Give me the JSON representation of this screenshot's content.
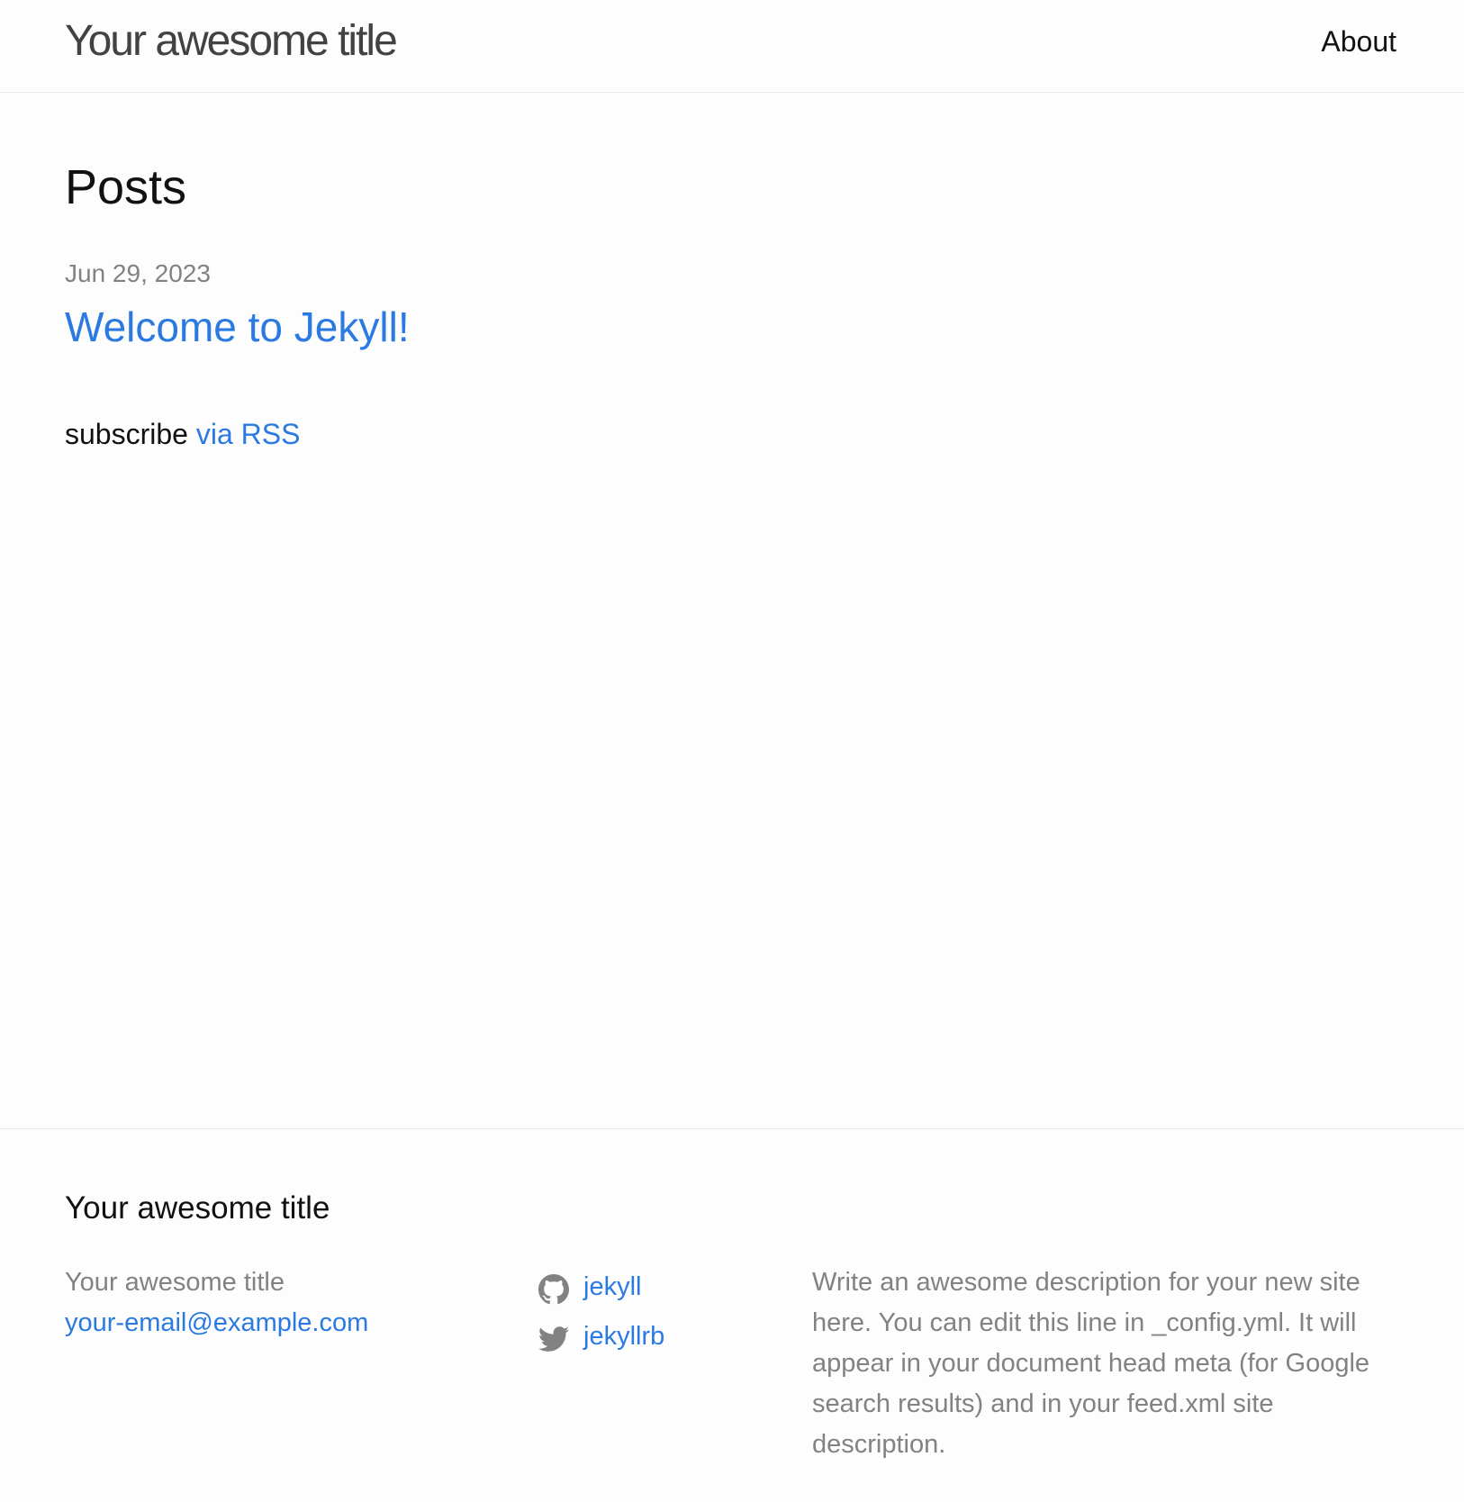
{
  "header": {
    "title": "Your awesome title",
    "nav": {
      "about": "About"
    }
  },
  "main": {
    "heading": "Posts",
    "posts": [
      {
        "date": "Jun 29, 2023",
        "title": "Welcome to Jekyll!"
      }
    ],
    "rss": {
      "prefix": "subscribe",
      "link": "via RSS"
    }
  },
  "footer": {
    "heading": "Your awesome title",
    "name": "Your awesome title",
    "email": "your-email@example.com",
    "social": [
      {
        "icon": "github-icon",
        "label": "jekyll"
      },
      {
        "icon": "twitter-icon",
        "label": "jekyllrb"
      }
    ],
    "description": "Write an awesome description for your new site here. You can edit this line in _config.yml. It will appear in your document head meta (for Google search results) and in your feed.xml site description."
  },
  "colors": {
    "link": "#2a7ae2",
    "muted": "#828282",
    "text": "#111111",
    "border": "#e8e8e8",
    "background": "#fdfdfd"
  }
}
